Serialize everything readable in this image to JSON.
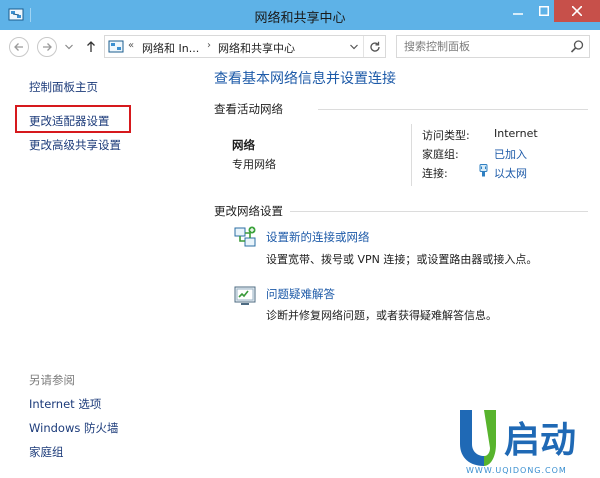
{
  "window": {
    "title": "网络和共享中心"
  },
  "address_bar": {
    "breadcrumbs": [
      "网络和 In...",
      "网络和共享中心"
    ],
    "overflow_marker": "«"
  },
  "search": {
    "placeholder": "搜索控制面板"
  },
  "left_nav": {
    "home": "控制面板主页",
    "links": [
      "更改适配器设置",
      "更改高级共享设置"
    ],
    "see_also_heading": "另请参阅",
    "see_also": [
      "Internet 选项",
      "Windows 防火墙",
      "家庭组"
    ]
  },
  "main": {
    "title": "查看基本网络信息并设置连接",
    "active_networks_heading": "查看活动网络",
    "network": {
      "name": "网络",
      "category": "专用网络",
      "access_type_label": "访问类型:",
      "access_type_value": "Internet",
      "homegroup_label": "家庭组:",
      "homegroup_value": "已加入",
      "connections_label": "连接:",
      "connections_value": "以太网"
    },
    "change_settings_heading": "更改网络设置",
    "tasks": [
      {
        "link": "设置新的连接或网络",
        "description": "设置宽带、拨号或 VPN 连接；或设置路由器或接入点。"
      },
      {
        "link": "问题疑难解答",
        "description": "诊断并修复网络问题，或者获得疑难解答信息。"
      }
    ]
  },
  "watermark": {
    "brand": "U启动",
    "url": "WWW.UQIDONG.COM"
  },
  "colors": {
    "titlebar": "#5eb2e7",
    "close_button": "#c7504a",
    "link": "#1c3b7a",
    "accent_link": "#1d5aa8",
    "highlight_box": "#d6191d"
  }
}
